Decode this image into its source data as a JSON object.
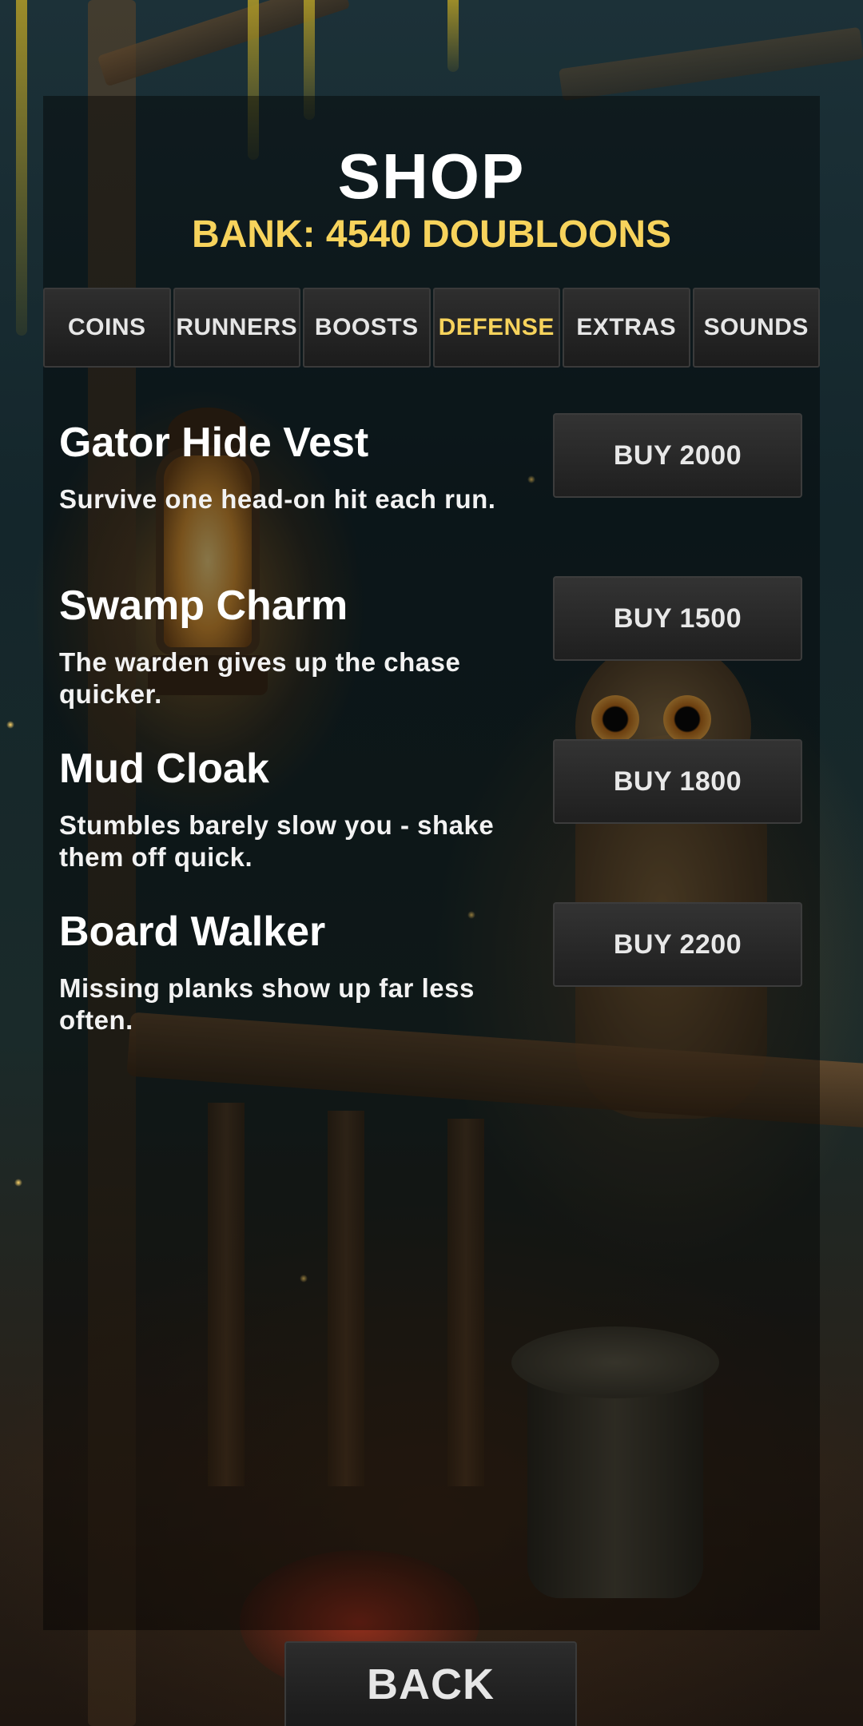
{
  "header": {
    "title": "SHOP",
    "bank_label": "BANK: 4540 DOUBLOONS"
  },
  "tabs": [
    {
      "label": "COINS",
      "active": false
    },
    {
      "label": "RUNNERS",
      "active": false
    },
    {
      "label": "BOOSTS",
      "active": false
    },
    {
      "label": "DEFENSE",
      "active": true
    },
    {
      "label": "EXTRAS",
      "active": false
    },
    {
      "label": "SOUNDS",
      "active": false
    }
  ],
  "items": [
    {
      "name": "Gator Hide Vest",
      "description": "Survive one head-on hit each run.",
      "buy_label": "BUY 2000"
    },
    {
      "name": "Swamp Charm",
      "description": "The warden gives up the chase quicker.",
      "buy_label": "BUY 1500"
    },
    {
      "name": "Mud Cloak",
      "description": "Stumbles barely slow you - shake them off quick.",
      "buy_label": "BUY 1800"
    },
    {
      "name": "Board Walker",
      "description": "Missing planks show up far less often.",
      "buy_label": "BUY 2200"
    }
  ],
  "footer": {
    "back_label": "BACK"
  },
  "colors": {
    "accent": "#f7d35c",
    "text": "#ffffff",
    "button_bg": "#262626"
  }
}
